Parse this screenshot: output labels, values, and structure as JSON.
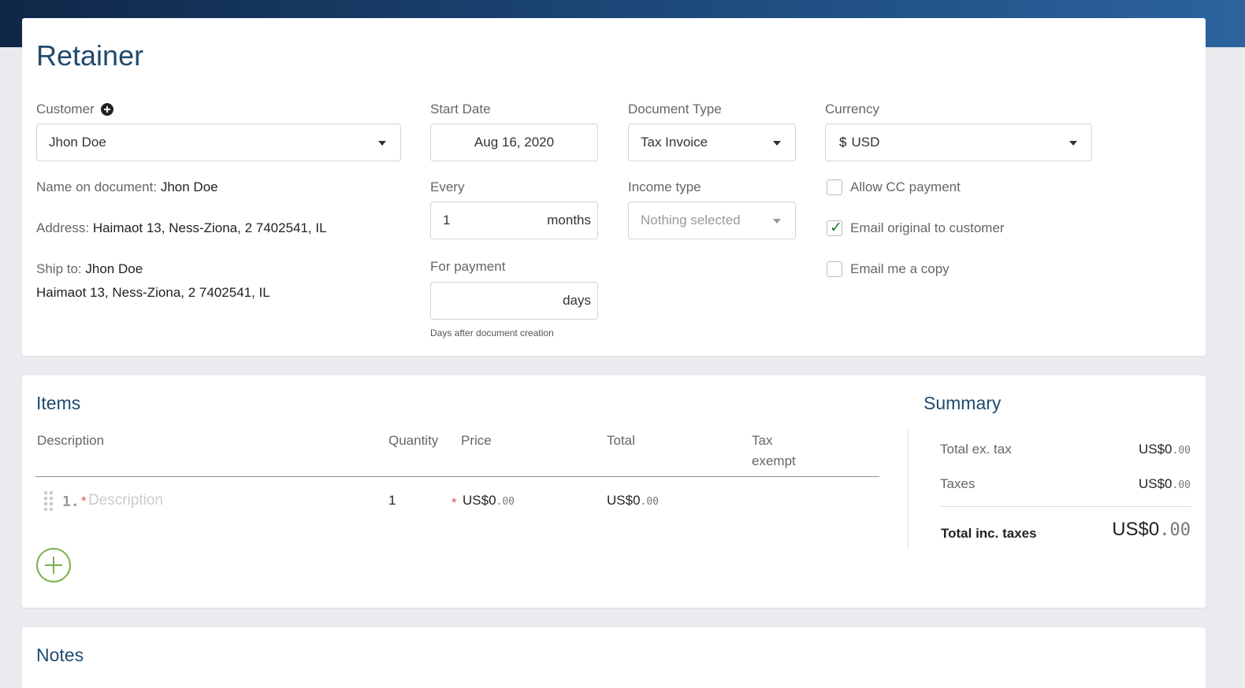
{
  "page": {
    "title": "Retainer"
  },
  "customer": {
    "label": "Customer",
    "value": "Jhon Doe",
    "name_label": "Name on document:",
    "name_value": "Jhon Doe",
    "address_label": "Address:",
    "address_value": "Haimaot 13, Ness-Ziona, 2 7402541, IL",
    "ship_label": "Ship to:",
    "ship_name": "Jhon Doe",
    "ship_address": "Haimaot 13, Ness-Ziona, 2 7402541, IL"
  },
  "start_date": {
    "label": "Start Date",
    "value": "Aug 16, 2020"
  },
  "every": {
    "label": "Every",
    "value": "1",
    "unit": "months"
  },
  "for_payment": {
    "label": "For payment",
    "value": "",
    "unit": "days",
    "hint": "Days after document creation"
  },
  "document_type": {
    "label": "Document Type",
    "value": "Tax Invoice"
  },
  "income_type": {
    "label": "Income type",
    "placeholder": "Nothing selected"
  },
  "currency": {
    "label": "Currency",
    "symbol": "$",
    "value": "USD"
  },
  "options": [
    {
      "label": "Allow CC payment",
      "checked": false
    },
    {
      "label": "Email original to customer",
      "checked": true
    },
    {
      "label": "Email me a copy",
      "checked": false
    }
  ],
  "items": {
    "title": "Items",
    "headers": {
      "description": "Description",
      "quantity": "Quantity",
      "price": "Price",
      "total": "Total",
      "tax_exempt_1": "Tax",
      "tax_exempt_2": "exempt"
    },
    "rows": [
      {
        "index": "1.",
        "required_mark": "*",
        "description_placeholder": "Description",
        "quantity": "1",
        "price_prefix": "US$0",
        "price_cents": ".00",
        "total_prefix": "US$0",
        "total_cents": ".00"
      }
    ]
  },
  "summary": {
    "title": "Summary",
    "total_ex_tax_label": "Total ex. tax",
    "total_ex_tax_prefix": "US$0",
    "total_ex_tax_cents": ".00",
    "taxes_label": "Taxes",
    "taxes_prefix": "US$0",
    "taxes_cents": ".00",
    "total_inc_label": "Total inc. taxes",
    "total_inc_prefix": "US$0",
    "total_inc_cents": ".00"
  },
  "notes": {
    "title": "Notes"
  },
  "colors": {
    "accent": "#1f4a6e",
    "add_button": "#7ab04a",
    "check": "#1b7a1b",
    "required": "#d9534f"
  }
}
